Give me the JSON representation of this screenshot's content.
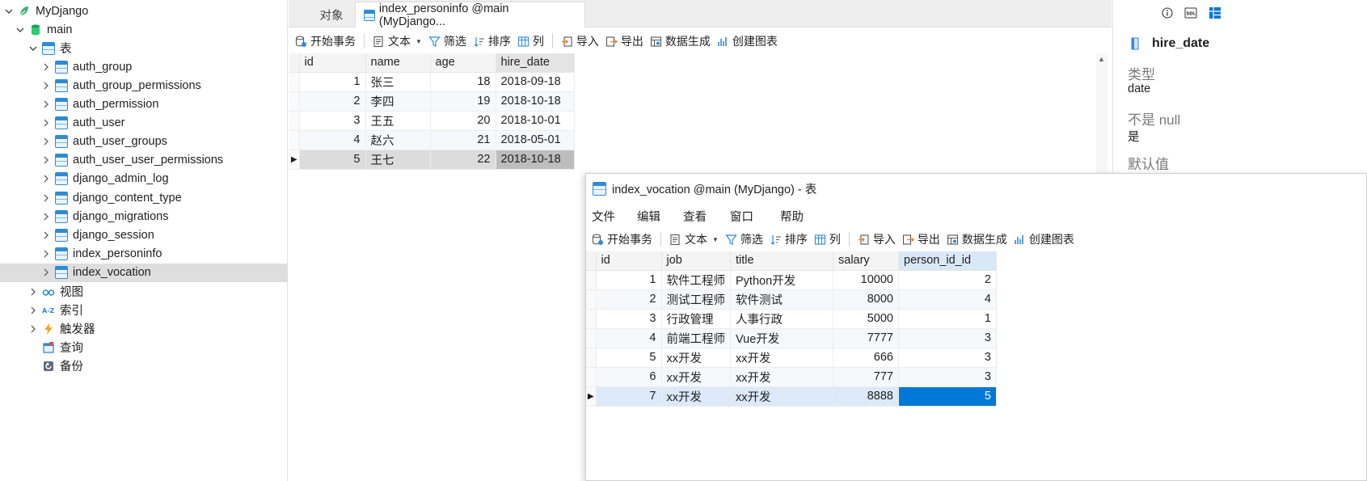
{
  "tree": {
    "connection": "MyDjango",
    "database": "main",
    "tables_label": "表",
    "tables": [
      "auth_group",
      "auth_group_permissions",
      "auth_permission",
      "auth_user",
      "auth_user_groups",
      "auth_user_user_permissions",
      "django_admin_log",
      "django_content_type",
      "django_migrations",
      "django_session",
      "index_personinfo",
      "index_vocation"
    ],
    "views": "视图",
    "indexes": "索引",
    "triggers": "触发器",
    "queries": "查询",
    "backups": "备份"
  },
  "tabs": {
    "objects": "对象",
    "active": "index_personinfo @main (MyDjango..."
  },
  "toolbar": {
    "begin_tx": "开始事务",
    "text": "文本",
    "filter": "筛选",
    "sort": "排序",
    "columns": "列",
    "import": "导入",
    "export": "导出",
    "data_gen": "数据生成",
    "create_chart": "创建图表"
  },
  "personinfo": {
    "columns": [
      "id",
      "name",
      "age",
      "hire_date"
    ],
    "rows": [
      [
        "1",
        "张三",
        "18",
        "2018-09-18"
      ],
      [
        "2",
        "李四",
        "19",
        "2018-10-18"
      ],
      [
        "3",
        "王五",
        "20",
        "2018-10-01"
      ],
      [
        "4",
        "赵六",
        "21",
        "2018-05-01"
      ],
      [
        "5",
        "王七",
        "22",
        "2018-10-18"
      ]
    ]
  },
  "props": {
    "field": "hire_date",
    "type_label": "类型",
    "type_value": "date",
    "notnull_label": "不是 null",
    "notnull_value": "是",
    "default_label": "默认值"
  },
  "vocation_window": {
    "title": "index_vocation @main (MyDjango) - 表",
    "menu": [
      "文件",
      "编辑",
      "查看",
      "窗口",
      "帮助"
    ],
    "columns": [
      "id",
      "job",
      "title",
      "salary",
      "person_id_id"
    ],
    "rows": [
      [
        "1",
        "软件工程师",
        "Python开发",
        "10000",
        "2"
      ],
      [
        "2",
        "测试工程师",
        "软件测试",
        "8000",
        "4"
      ],
      [
        "3",
        "行政管理",
        "人事行政",
        "5000",
        "1"
      ],
      [
        "4",
        "前端工程师",
        "Vue开发",
        "7777",
        "3"
      ],
      [
        "5",
        "xx开发",
        "xx开发",
        "666",
        "3"
      ],
      [
        "6",
        "xx开发",
        "xx开发",
        "777",
        "3"
      ],
      [
        "7",
        "xx开发",
        "xx开发",
        "8888",
        "5"
      ]
    ]
  },
  "colors": {
    "accent": "#0078d7",
    "selected_row": "#dbe9f8",
    "tree_selected": "#dedede"
  }
}
